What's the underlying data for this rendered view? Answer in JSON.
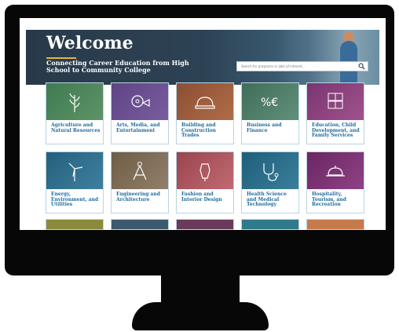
{
  "hero": {
    "title": "Welcome",
    "subtitle": "Connecting Career Education from High School to Community College",
    "search_placeholder": "Search for programs or jobs of interest..."
  },
  "colors": {
    "hero_bg": "#2d4254",
    "accent_rule": "#e6b53a",
    "link": "#1f6b9c",
    "tile_border": "#b9d4e4"
  },
  "tiles": [
    {
      "label": "Agriculture and Natural Resources",
      "icon": "wheat-icon",
      "color": "#4a7d56"
    },
    {
      "label": "Arts, Media, and Entertainment",
      "icon": "film-reel-icon",
      "color": "#6a4d8c"
    },
    {
      "label": "Building and Construction Trades",
      "icon": "hardhat-icon",
      "color": "#9a5a3a"
    },
    {
      "label": "Business and Finance",
      "icon": "percent-euro-icon",
      "color": "#4f7a62"
    },
    {
      "label": "Education, Child Development, and Family Services",
      "icon": "blocks-icon",
      "color": "#8a3f7a"
    },
    {
      "label": "Energy, Environment, and Utilities",
      "icon": "wind-turbine-icon",
      "color": "#2f6a8c"
    },
    {
      "label": "Engineering and Architecture",
      "icon": "compass-icon",
      "color": "#7a6650"
    },
    {
      "label": "Fashion and Interior Design",
      "icon": "dress-form-icon",
      "color": "#a8505a"
    },
    {
      "label": "Health Science and Medical Technology",
      "icon": "stethoscope-icon",
      "color": "#2a6a86"
    },
    {
      "label": "Hospitality, Tourism, and Recreation",
      "icon": "serving-tray-icon",
      "color": "#7a2f72"
    }
  ],
  "partial_tiles": [
    {
      "color": "#8a8a3a"
    },
    {
      "color": "#3c5a6e"
    },
    {
      "color": "#6a3a5a"
    },
    {
      "color": "#2e7a8a"
    },
    {
      "color": "#c67a4a"
    }
  ]
}
